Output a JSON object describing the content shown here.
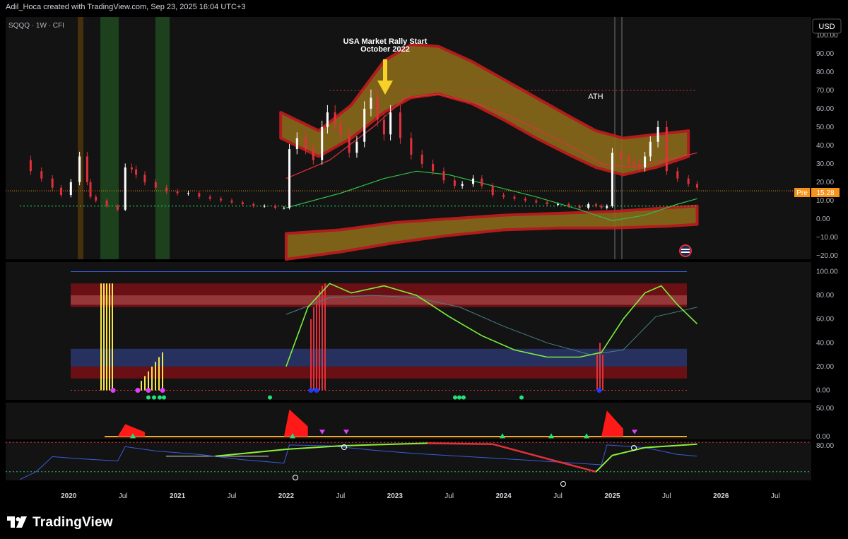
{
  "header": {
    "text": "Adil_Hoca created with TradingView.com, Sep 23, 2025 16:04 UTC+3"
  },
  "symbol_label": "SQQQ · 1W · CFI",
  "currency_button": "USD",
  "annotation": {
    "line1": "USA Market Rally Start",
    "line2": "October 2022"
  },
  "ath_label": "ATH",
  "price_tag": {
    "session": "Pre",
    "value": "15.28"
  },
  "flag_icon": "us-flag-icon",
  "footer": {
    "logo_text": "TradingView",
    "logo_icon": "tradingview-logo-icon"
  },
  "colors": {
    "background": "#000000",
    "panel": "#131313",
    "bull": "#ffffff",
    "bear": "#e0313a",
    "band_red": "#c41e1e",
    "band_olive": "#8a6a1a",
    "accent_yellow": "#f6e64a",
    "price_tag": "#f7931a",
    "green_dotted": "#22c55e",
    "blue_line": "#3a5bdc"
  },
  "chart_data": [
    {
      "id": "price",
      "type": "candlestick",
      "title": "SQQQ · 1W · CFI",
      "ylim": [
        -22,
        110
      ],
      "y_ticks": [
        "100.00",
        "90.00",
        "80.00",
        "70.00",
        "60.00",
        "50.00",
        "40.00",
        "30.00",
        "20.00",
        "10.00",
        "0.00",
        "−10.00",
        "−20.00"
      ],
      "x_ticks": [
        "2020",
        "Jul",
        "2021",
        "Jul",
        "2022",
        "Jul",
        "2023",
        "Jul",
        "2024",
        "Jul",
        "2025",
        "Jul",
        "2026",
        "Jul"
      ],
      "x_domain": [
        2019.42,
        2026.83
      ],
      "series": [
        {
          "name": "close",
          "x": [
            2019.55,
            2019.65,
            2019.75,
            2019.85,
            2019.93,
            2020.02,
            2020.1,
            2020.17,
            2020.2,
            2020.25,
            2020.35,
            2020.45,
            2020.52,
            2020.58,
            2020.62,
            2020.7,
            2020.8,
            2020.9,
            2021.0,
            2021.1,
            2021.2,
            2021.3,
            2021.4,
            2021.5,
            2021.6,
            2021.7,
            2021.8,
            2021.9,
            2021.98,
            2022.03,
            2022.1,
            2022.18,
            2022.25,
            2022.33,
            2022.38,
            2022.45,
            2022.5,
            2022.58,
            2022.65,
            2022.72,
            2022.78,
            2022.84,
            2022.9,
            2022.96,
            2023.05,
            2023.15,
            2023.25,
            2023.35,
            2023.45,
            2023.55,
            2023.62,
            2023.72,
            2023.8,
            2023.9,
            2024.0,
            2024.1,
            2024.2,
            2024.3,
            2024.4,
            2024.5,
            2024.6,
            2024.7,
            2024.78,
            2024.85,
            2024.9,
            2024.95,
            2025.0,
            2025.08,
            2025.15,
            2025.2,
            2025.25,
            2025.3,
            2025.35,
            2025.42,
            2025.5,
            2025.6,
            2025.7,
            2025.78
          ],
          "values": [
            32,
            26,
            22,
            17,
            13,
            20,
            34,
            20,
            12,
            10,
            7,
            5,
            28,
            27,
            24,
            20,
            17,
            15,
            14,
            14,
            12,
            11,
            10,
            9,
            8,
            7,
            7,
            6,
            6,
            38,
            44,
            38,
            32,
            50,
            58,
            52,
            46,
            36,
            42,
            60,
            66,
            54,
            46,
            58,
            44,
            35,
            30,
            26,
            21,
            18,
            19,
            22,
            18,
            13,
            12,
            11,
            10,
            9,
            8,
            8,
            7,
            6,
            8,
            7,
            6,
            7,
            36,
            33,
            31,
            30,
            28,
            34,
            42,
            50,
            26,
            22,
            19,
            17
          ]
        },
        {
          "name": "upper_band_top",
          "x": [
            2021.95,
            2022.3,
            2022.6,
            2022.9,
            2023.15,
            2023.4,
            2023.7,
            2024.0,
            2024.3,
            2024.6,
            2024.85,
            2025.1,
            2025.4,
            2025.7
          ],
          "values": [
            58,
            48,
            62,
            86,
            95,
            94,
            86,
            76,
            66,
            56,
            48,
            44,
            46,
            48
          ]
        },
        {
          "name": "upper_band_bottom",
          "x": [
            2021.95,
            2022.3,
            2022.6,
            2022.9,
            2023.15,
            2023.4,
            2023.7,
            2024.0,
            2024.3,
            2024.6,
            2024.85,
            2025.1,
            2025.4,
            2025.7
          ],
          "values": [
            44,
            34,
            44,
            58,
            66,
            68,
            63,
            54,
            44,
            35,
            28,
            24,
            28,
            34
          ]
        },
        {
          "name": "lower_band_top",
          "x": [
            2022.0,
            2022.5,
            2023.0,
            2023.5,
            2024.0,
            2024.5,
            2025.0,
            2025.5,
            2025.78
          ],
          "values": [
            -8,
            -6,
            -2,
            0,
            2,
            3,
            4,
            6,
            7
          ]
        },
        {
          "name": "lower_band_bottom",
          "x": [
            2022.0,
            2022.5,
            2023.0,
            2023.5,
            2024.0,
            2024.5,
            2025.0,
            2025.5,
            2025.78
          ],
          "values": [
            -22,
            -18,
            -13,
            -9,
            -6,
            -5,
            -5,
            -4,
            -3
          ]
        },
        {
          "name": "red_ma",
          "x": [
            2022.0,
            2022.4,
            2022.8,
            2023.1,
            2023.4,
            2023.8,
            2024.2,
            2024.6,
            2024.9,
            2025.2,
            2025.5,
            2025.78
          ],
          "values": [
            22,
            32,
            50,
            66,
            68,
            62,
            52,
            40,
            30,
            28,
            32,
            36
          ]
        },
        {
          "name": "green_ma",
          "x": [
            2022.0,
            2022.5,
            2022.9,
            2023.2,
            2023.5,
            2023.9,
            2024.3,
            2024.7,
            2025.0,
            2025.3,
            2025.6,
            2025.78
          ],
          "values": [
            6,
            14,
            22,
            26,
            24,
            18,
            12,
            5,
            -1,
            2,
            8,
            11
          ]
        },
        {
          "name": "ath_line",
          "x": [
            2022.4,
            2025.78
          ],
          "values": [
            70,
            70
          ]
        },
        {
          "name": "support_line",
          "x": [
            2019.55,
            2025.78
          ],
          "values": [
            7,
            7
          ]
        }
      ]
    },
    {
      "id": "oscillator1",
      "type": "line",
      "ylim": [
        -8,
        108
      ],
      "y_ticks": [
        "100.00",
        "80.00",
        "60.00",
        "40.00",
        "20.00",
        "0.00"
      ],
      "series": [
        {
          "name": "fast_line",
          "x": [
            2022.0,
            2022.2,
            2022.4,
            2022.6,
            2022.9,
            2023.2,
            2023.5,
            2023.8,
            2024.1,
            2024.4,
            2024.7,
            2024.9,
            2025.1,
            2025.3,
            2025.45,
            2025.6,
            2025.78
          ],
          "values": [
            20,
            70,
            90,
            82,
            88,
            80,
            62,
            46,
            34,
            28,
            28,
            32,
            60,
            82,
            88,
            72,
            56
          ]
        },
        {
          "name": "slow_line",
          "x": [
            2022.0,
            2022.4,
            2022.8,
            2023.2,
            2023.6,
            2024.0,
            2024.4,
            2024.8,
            2025.1,
            2025.4,
            2025.78
          ],
          "values": [
            64,
            78,
            80,
            78,
            70,
            54,
            40,
            30,
            34,
            62,
            70
          ]
        }
      ]
    },
    {
      "id": "oscillator2",
      "type": "area",
      "ylim": [
        -5,
        60
      ],
      "y_ticks": [
        "50.00",
        "0.00"
      ],
      "series": [
        {
          "name": "spikes",
          "x": [
            2020.45,
            2020.52,
            2020.7,
            2021.98,
            2022.03,
            2022.2,
            2022.4,
            2024.9,
            2024.95,
            2025.1,
            2025.3
          ],
          "values": [
            0,
            22,
            8,
            0,
            48,
            18,
            4,
            0,
            46,
            14,
            3
          ]
        }
      ]
    },
    {
      "id": "oscillator3",
      "type": "line",
      "ylim": [
        0,
        90
      ],
      "y_ticks": [
        "80.00"
      ],
      "series": [
        {
          "name": "blue_line",
          "x": [
            2019.55,
            2019.7,
            2019.85,
            2020.1,
            2020.45,
            2020.52,
            2020.8,
            2021.2,
            2021.6,
            2021.98,
            2022.03,
            2022.4,
            2022.8,
            2023.2,
            2023.6,
            2024.0,
            2024.4,
            2024.9,
            2024.95,
            2025.3,
            2025.6,
            2025.78
          ],
          "values": [
            2,
            20,
            55,
            50,
            45,
            78,
            68,
            60,
            48,
            40,
            82,
            80,
            70,
            62,
            56,
            50,
            44,
            36,
            82,
            76,
            60,
            56
          ]
        },
        {
          "name": "green_line",
          "x": [
            2021.35,
            2022.0,
            2022.5,
            2023.0,
            2023.3
          ],
          "values": [
            56,
            72,
            80,
            84,
            86
          ]
        },
        {
          "name": "red_line",
          "x": [
            2023.3,
            2023.9,
            2024.85
          ],
          "values": [
            86,
            84,
            20
          ]
        },
        {
          "name": "green_recovery",
          "x": [
            2024.85,
            2025.0,
            2025.3,
            2025.78
          ],
          "values": [
            20,
            58,
            76,
            84
          ]
        }
      ]
    }
  ]
}
